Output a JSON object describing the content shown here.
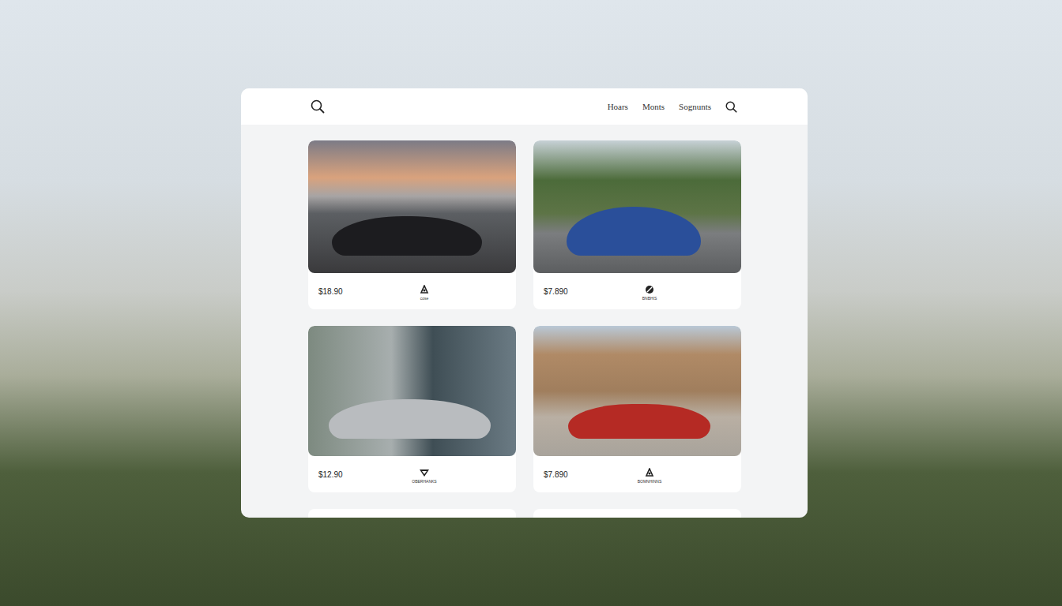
{
  "header": {
    "nav": [
      {
        "label": "Hoars"
      },
      {
        "label": "Monts"
      },
      {
        "label": "Sognunts"
      }
    ]
  },
  "cards": [
    {
      "price": "$18.90",
      "brand": "cose"
    },
    {
      "price": "$7.890",
      "brand": "BNBHIS"
    },
    {
      "price": "$12.90",
      "brand": "OBERHANKS"
    },
    {
      "price": "$7.890",
      "brand": "BOMNHINNS"
    }
  ]
}
